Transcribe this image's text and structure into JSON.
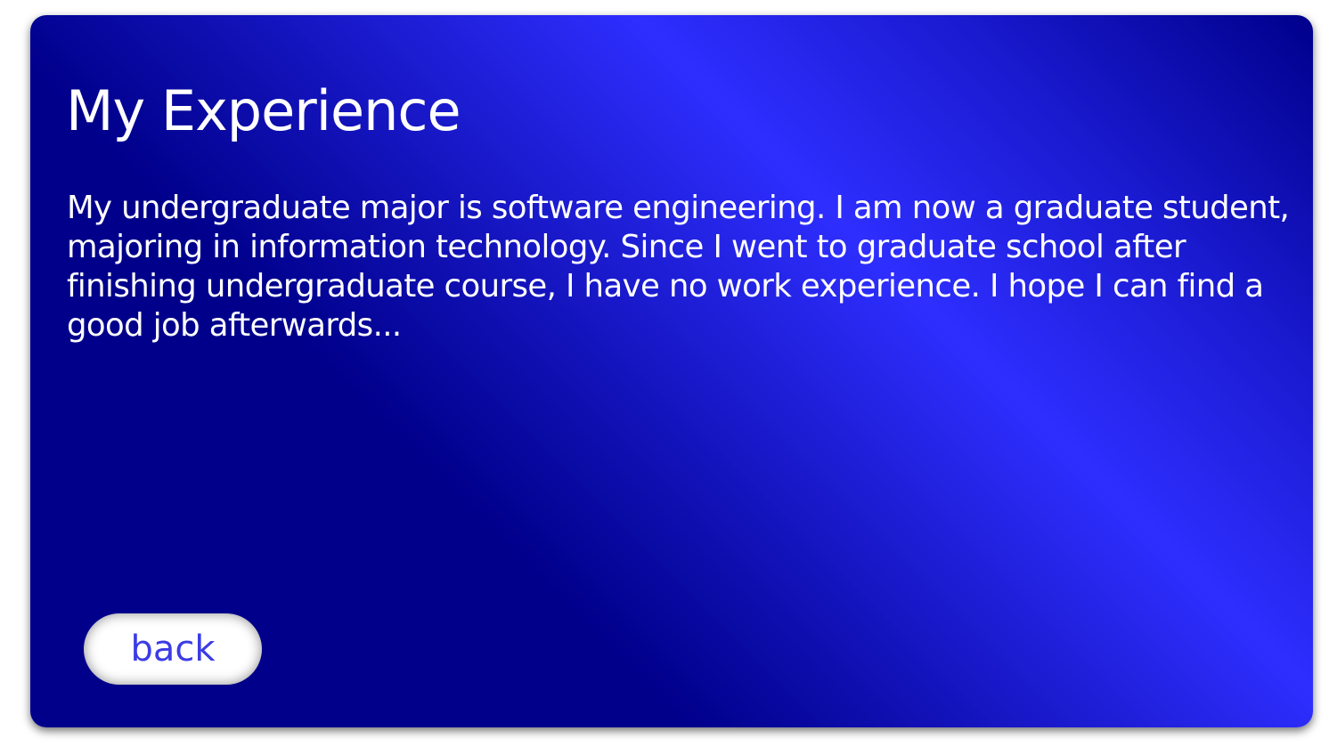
{
  "page": {
    "title": "My Experience",
    "description": "My undergraduate major is software engineering. I am now a graduate student, majoring in information technology. Since I went to graduate school after finishing undergraduate course, I have no work experience. I hope I can find a good job afterwards...",
    "back_label": "back"
  },
  "colors": {
    "background_dark": "#00008b",
    "background_bright": "#2e2eff",
    "button_text": "#3b3be6"
  }
}
